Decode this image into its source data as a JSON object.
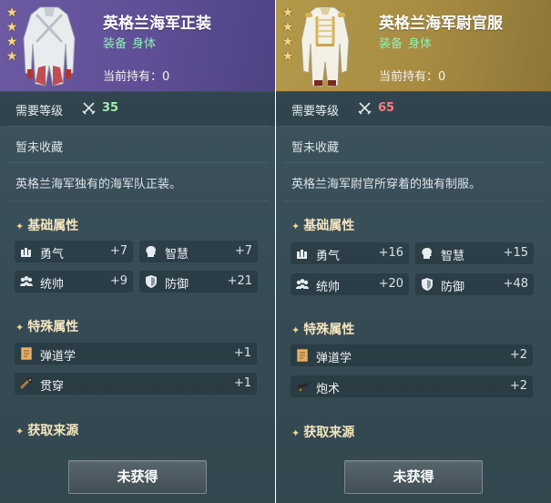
{
  "cards": [
    {
      "title": "英格兰海军正装",
      "tag_type": "装备",
      "tag_slot": "身体",
      "holding": "当前持有：0",
      "level_label": "需要等级",
      "level_value": "35",
      "collect_status": "暂未收藏",
      "description": "英格兰海军独有的海军队正装。",
      "basic_title": "基础属性",
      "basic_stats": [
        {
          "label": "勇气",
          "value": "+7",
          "icon": "courage-icon"
        },
        {
          "label": "智慧",
          "value": "+7",
          "icon": "wisdom-icon"
        },
        {
          "label": "统帅",
          "value": "+9",
          "icon": "command-icon"
        },
        {
          "label": "防御",
          "value": "+21",
          "icon": "defense-icon"
        }
      ],
      "special_title": "特殊属性",
      "special_stats": [
        {
          "label": "弹道学",
          "value": "+1",
          "icon": "ballistics-book-icon"
        },
        {
          "label": "贯穿",
          "value": "+1",
          "icon": "penetration-gun-icon"
        }
      ],
      "source_title": "获取来源",
      "button_label": "未获得",
      "rarity_stars": 4,
      "colors": {
        "header": "#6c5aa3",
        "level_value": "#9ef0a8"
      }
    },
    {
      "title": "英格兰海军尉官服",
      "tag_type": "装备",
      "tag_slot": "身体",
      "holding": "当前持有：0",
      "level_label": "需要等级",
      "level_value": "65",
      "collect_status": "暂未收藏",
      "description": "英格兰海军尉官所穿着的独有制服。",
      "basic_title": "基础属性",
      "basic_stats": [
        {
          "label": "勇气",
          "value": "+16",
          "icon": "courage-icon"
        },
        {
          "label": "智慧",
          "value": "+15",
          "icon": "wisdom-icon"
        },
        {
          "label": "统帅",
          "value": "+20",
          "icon": "command-icon"
        },
        {
          "label": "防御",
          "value": "+48",
          "icon": "defense-icon"
        }
      ],
      "special_title": "特殊属性",
      "special_stats": [
        {
          "label": "弹道学",
          "value": "+2",
          "icon": "ballistics-book-icon"
        },
        {
          "label": "炮术",
          "value": "+2",
          "icon": "gunnery-cannon-icon"
        }
      ],
      "source_title": "获取来源",
      "button_label": "未获得",
      "rarity_stars": 4,
      "colors": {
        "header": "#b3994a",
        "level_value": "#ff7a7a"
      }
    }
  ]
}
